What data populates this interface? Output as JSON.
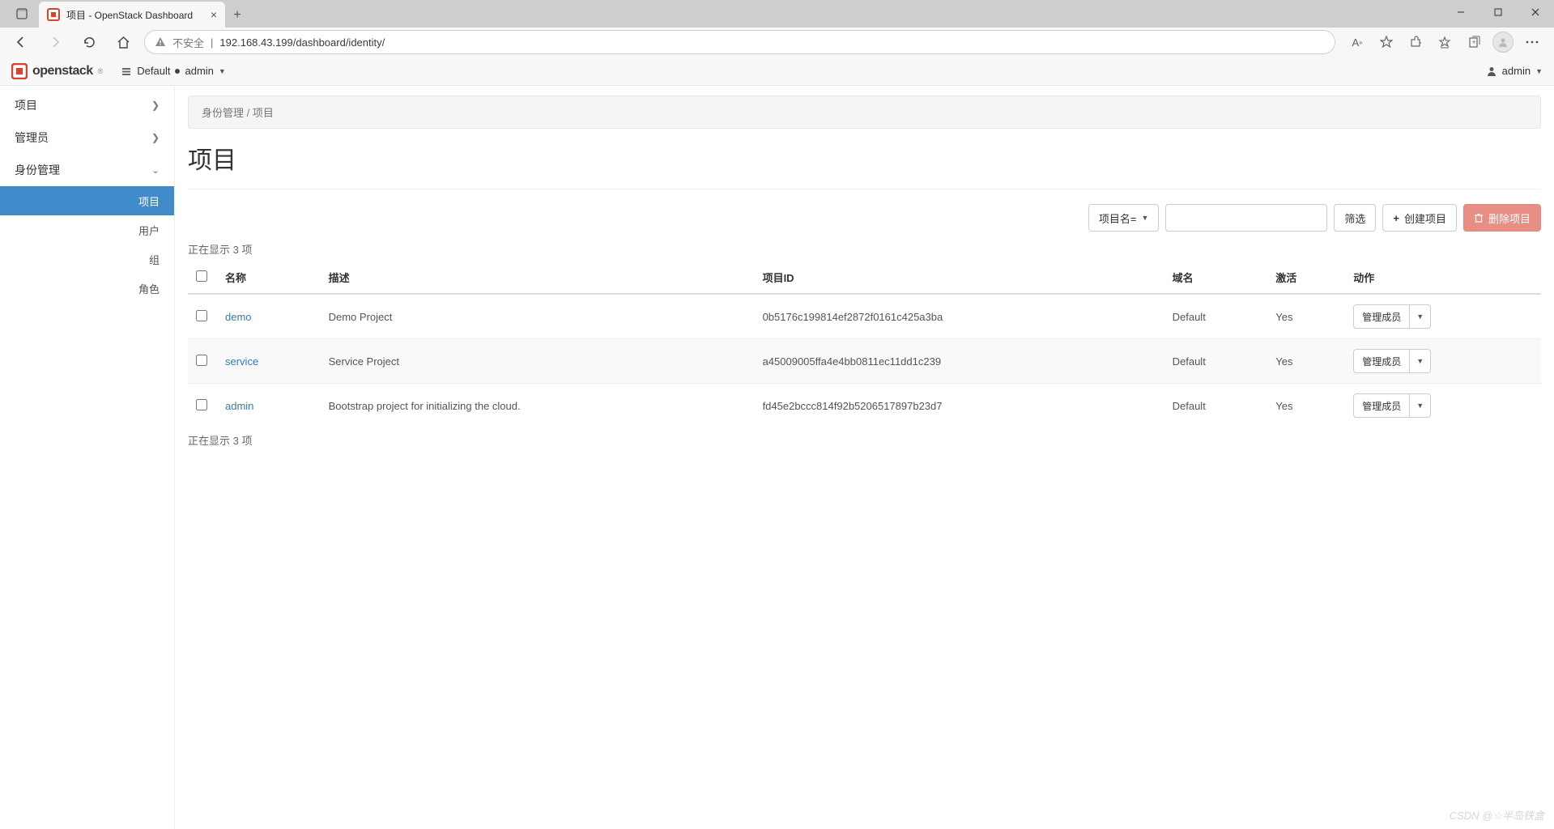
{
  "browser": {
    "tab_title": "项目 - OpenStack Dashboard",
    "insecure_label": "不安全",
    "url": "192.168.43.199/dashboard/identity/"
  },
  "topbar": {
    "brand": "openstack",
    "domain_label": "Default",
    "user_short": "admin",
    "right_user": "admin"
  },
  "sidebar": {
    "items": [
      {
        "label": "项目",
        "expandable": true,
        "expanded": false
      },
      {
        "label": "管理员",
        "expandable": true,
        "expanded": false
      },
      {
        "label": "身份管理",
        "expandable": true,
        "expanded": true
      }
    ],
    "identity_children": [
      {
        "label": "项目",
        "active": true
      },
      {
        "label": "用户",
        "active": false
      },
      {
        "label": "组",
        "active": false
      },
      {
        "label": "角色",
        "active": false
      }
    ]
  },
  "breadcrumb": {
    "parent": "身份管理",
    "current": "项目"
  },
  "page": {
    "title": "项目"
  },
  "toolbar": {
    "filter_field": "项目名=",
    "filter_btn": "筛选",
    "create_btn": "创建项目",
    "delete_btn": "删除项目"
  },
  "table": {
    "display_text_top": "正在显示 3 项",
    "display_text_bottom": "正在显示 3 项",
    "headers": {
      "name": "名称",
      "desc": "描述",
      "project_id": "项目ID",
      "domain": "域名",
      "active": "激活",
      "actions": "动作"
    },
    "row_action": "管理成员",
    "rows": [
      {
        "name": "demo",
        "desc": "Demo Project",
        "id": "0b5176c199814ef2872f0161c425a3ba",
        "domain": "Default",
        "active": "Yes"
      },
      {
        "name": "service",
        "desc": "Service Project",
        "id": "a45009005ffa4e4bb0811ec11dd1c239",
        "domain": "Default",
        "active": "Yes"
      },
      {
        "name": "admin",
        "desc": "Bootstrap project for initializing the cloud.",
        "id": "fd45e2bccc814f92b5206517897b23d7",
        "domain": "Default",
        "active": "Yes"
      }
    ]
  },
  "watermark": "CSDN @☆半岛铁盒"
}
